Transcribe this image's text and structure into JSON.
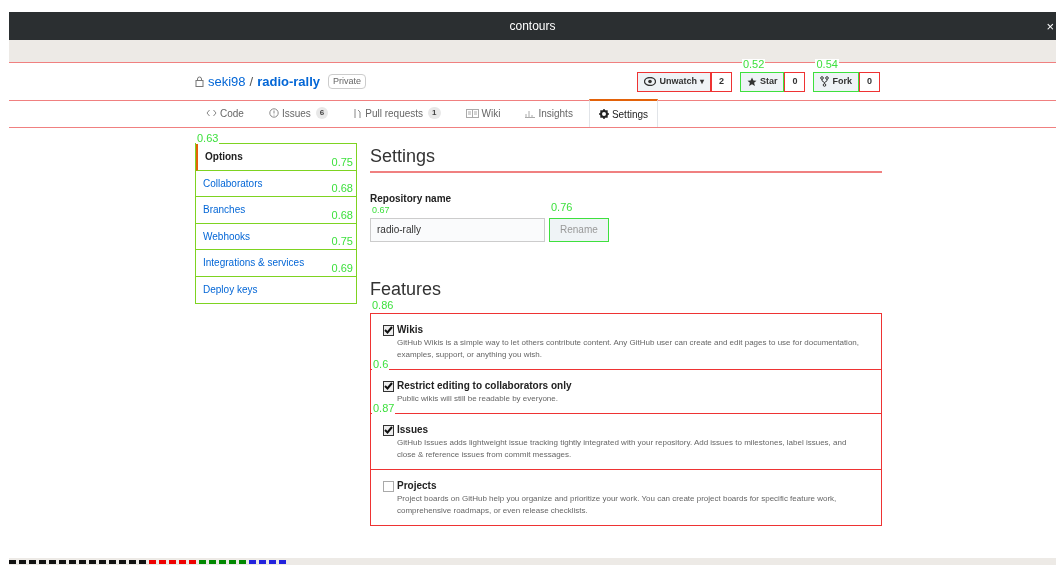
{
  "window": {
    "title": "contours",
    "close": "×"
  },
  "repo": {
    "owner": "seki98",
    "separator": "/",
    "name": "radio-rally",
    "badge": "Private"
  },
  "actions": [
    {
      "kind": "watch",
      "label": "Unwatch",
      "caret": "▾",
      "count": "2"
    },
    {
      "kind": "star",
      "label": "Star",
      "count": "0",
      "score": "0.52"
    },
    {
      "kind": "fork",
      "label": "Fork",
      "count": "0",
      "score": "0.54"
    }
  ],
  "tabs": [
    {
      "kind": "code",
      "label": "Code",
      "selected": false
    },
    {
      "kind": "issues",
      "label": "Issues",
      "count": "6",
      "selected": false
    },
    {
      "kind": "pulls",
      "label": "Pull requests",
      "count": "1",
      "selected": false
    },
    {
      "kind": "wiki",
      "label": "Wiki",
      "selected": false
    },
    {
      "kind": "insights",
      "label": "Insights",
      "selected": false
    },
    {
      "kind": "settings",
      "label": "Settings",
      "selected": true
    }
  ],
  "sidebar": {
    "top_score": "0.63",
    "items": [
      {
        "label": "Options",
        "selected": true,
        "score": "0.75"
      },
      {
        "label": "Collaborators",
        "selected": false,
        "score": "0.68"
      },
      {
        "label": "Branches",
        "selected": false,
        "score": "0.68"
      },
      {
        "label": "Webhooks",
        "selected": false,
        "score": "0.75"
      },
      {
        "label": "Integrations & services",
        "selected": false,
        "score": "0.69"
      },
      {
        "label": "Deploy keys",
        "selected": false
      }
    ]
  },
  "settings": {
    "heading": "Settings",
    "name_label": "Repository name",
    "name_value": "radio-rally",
    "input_score": "0.67",
    "rename": "Rename",
    "rename_score": "0.76"
  },
  "features": {
    "heading": "Features",
    "score": "0.86",
    "items": [
      {
        "title": "Wikis",
        "checked": true,
        "description": "GitHub Wikis is a simple way to let others contribute content. Any GitHub user can create and edit pages to use for documentation, examples, support, or anything you wish."
      },
      {
        "title": "Restrict editing to collaborators only",
        "checked": true,
        "description": "Public wikis will still be readable by everyone.",
        "score": "0.6"
      },
      {
        "title": "Issues",
        "checked": true,
        "description": "GitHub Issues adds lightweight issue tracking tightly integrated with your repository. Add issues to milestones, label issues, and close & reference issues from commit messages.",
        "score": "0.87"
      },
      {
        "title": "Projects",
        "checked": false,
        "description": "Project boards on GitHub help you organize and prioritize your work. You can create project boards for specific feature work, comprehensive roadmaps, or even release checklists."
      }
    ]
  }
}
